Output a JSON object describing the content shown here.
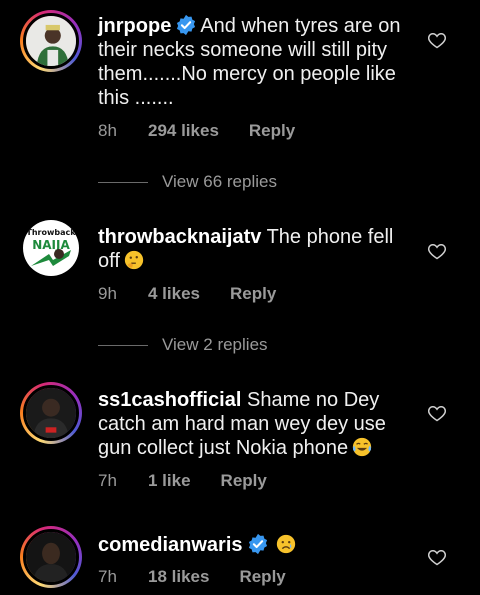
{
  "comments": [
    {
      "username": "jnrpope",
      "verified": true,
      "text": "And when tyres are on their necks someone will still pity them.......No mercy on people like this .......",
      "time": "8h",
      "likes": "294 likes",
      "reply_label": "Reply",
      "view_replies": "View 66 replies",
      "avatar_story_ring": true
    },
    {
      "username": "throwbacknaijatv",
      "verified": false,
      "text": "The phone fell off",
      "emoji": "thinking-face",
      "time": "9h",
      "likes": "4 likes",
      "reply_label": "Reply",
      "view_replies": "View 2 replies",
      "avatar_story_ring": false,
      "avatar_logo_text": "Throwback",
      "avatar_logo_word": "NAIJA"
    },
    {
      "username": "ss1cashofficial",
      "verified": false,
      "text": "Shame no Dey catch am hard man wey dey use gun collect just Nokia phone",
      "emoji": "tears-of-joy",
      "time": "7h",
      "likes": "1 like",
      "reply_label": "Reply",
      "avatar_story_ring": true
    },
    {
      "username": "comedianwaris",
      "verified": true,
      "text": "",
      "emoji": "crying-face",
      "time": "7h",
      "likes": "18 likes",
      "reply_label": "Reply",
      "avatar_story_ring": true
    }
  ],
  "colors": {
    "verified": "#3897f0",
    "secondary_text": "#9a9a9a",
    "background": "#000000"
  }
}
